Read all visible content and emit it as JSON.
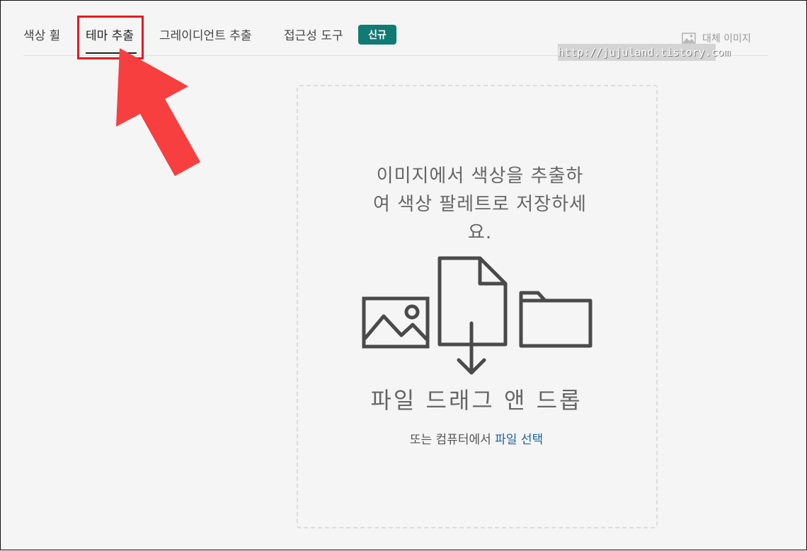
{
  "tabs": [
    {
      "label": "색상 휠"
    },
    {
      "label": "테마 추출"
    },
    {
      "label": "그레이디언트 추출"
    },
    {
      "label": "접근성 도구"
    }
  ],
  "badge": {
    "label": "신규"
  },
  "alt_image": {
    "label": "대체 이미지"
  },
  "watermark": {
    "text": "http://jujuland.tistory.com"
  },
  "dropzone": {
    "intro_line1": "이미지에서 색상을 추출하",
    "intro_line2": "여 색상 팔레트로 저장하세",
    "intro_line3": "요.",
    "drag_title": "파일 드래그 앤 드롭",
    "select_prefix": "또는 컴퓨터에서",
    "select_link": "파일 선택"
  },
  "colors": {
    "accent": "#0f7b73",
    "link": "#1f5f9b",
    "callout": "#e31b23",
    "arrow": "#f73f3f"
  },
  "icons": [
    "image-icon",
    "file-download-icon",
    "folder-icon"
  ]
}
